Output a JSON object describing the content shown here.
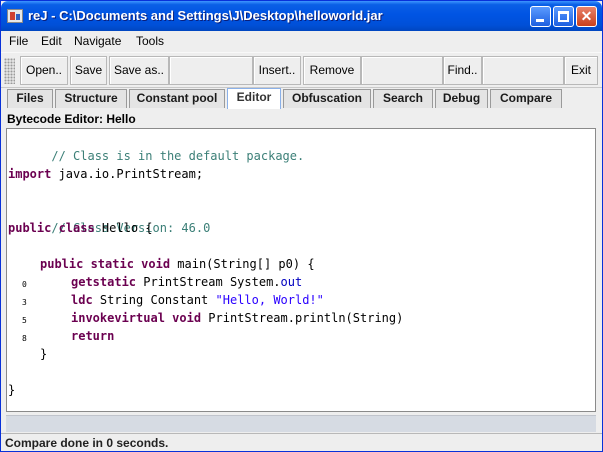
{
  "window": {
    "title": "reJ - C:\\Documents and Settings\\J\\Desktop\\helloworld.jar",
    "minimize_icon": "minimize-icon",
    "maximize_icon": "maximize-icon",
    "close_icon": "close-icon",
    "close_glyph": "✕"
  },
  "menu": {
    "items": [
      "File",
      "Edit",
      "Navigate",
      "Tools"
    ]
  },
  "toolbar": {
    "open_label": "Open..",
    "save_label": "Save",
    "save_as_label": "Save as..",
    "insert_label": "Insert..",
    "remove_label": "Remove",
    "find_label": "Find..",
    "exit_label": "Exit"
  },
  "tabs": [
    {
      "label": "Files",
      "active": false
    },
    {
      "label": "Structure",
      "active": false
    },
    {
      "label": "Constant pool",
      "active": false
    },
    {
      "label": "Editor",
      "active": true
    },
    {
      "label": "Obfuscation",
      "active": false
    },
    {
      "label": "Search",
      "active": false
    },
    {
      "label": "Debug",
      "active": false
    },
    {
      "label": "Compare",
      "active": false
    }
  ],
  "editor": {
    "panel_label": "Bytecode Editor: Hello",
    "code": {
      "comment_package": "// Class is in the default package.",
      "import_kw": "import",
      "import_rest": " java.io.PrintStream;",
      "comment_version": "// Class Version: 46.0",
      "class_kw": "public class",
      "class_rest": " Hello {",
      "method_kw": "public static void",
      "method_rest": " main(String[] p0) {",
      "line1_kw": "getstatic",
      "line1_type": " PrintStream System.",
      "line1_field": "out",
      "line2_kw": "ldc",
      "line2_rest": " String Constant ",
      "line2_str": "\"Hello, World!\"",
      "line3_kw": "invokevirtual",
      "line3_void": " void",
      "line3_rest": " PrintStream.println(String)",
      "line4_kw": "return",
      "method_close": "}",
      "class_close": "}"
    },
    "offsets": [
      "0",
      "3",
      "5",
      "8"
    ]
  },
  "status": {
    "text": "Compare done in 0 seconds."
  },
  "colors": {
    "titlebar": "#0054e3",
    "keyword": "#6b0050",
    "comment": "#3b7f77",
    "string": "#2a00ff",
    "field": "#0000c0"
  }
}
